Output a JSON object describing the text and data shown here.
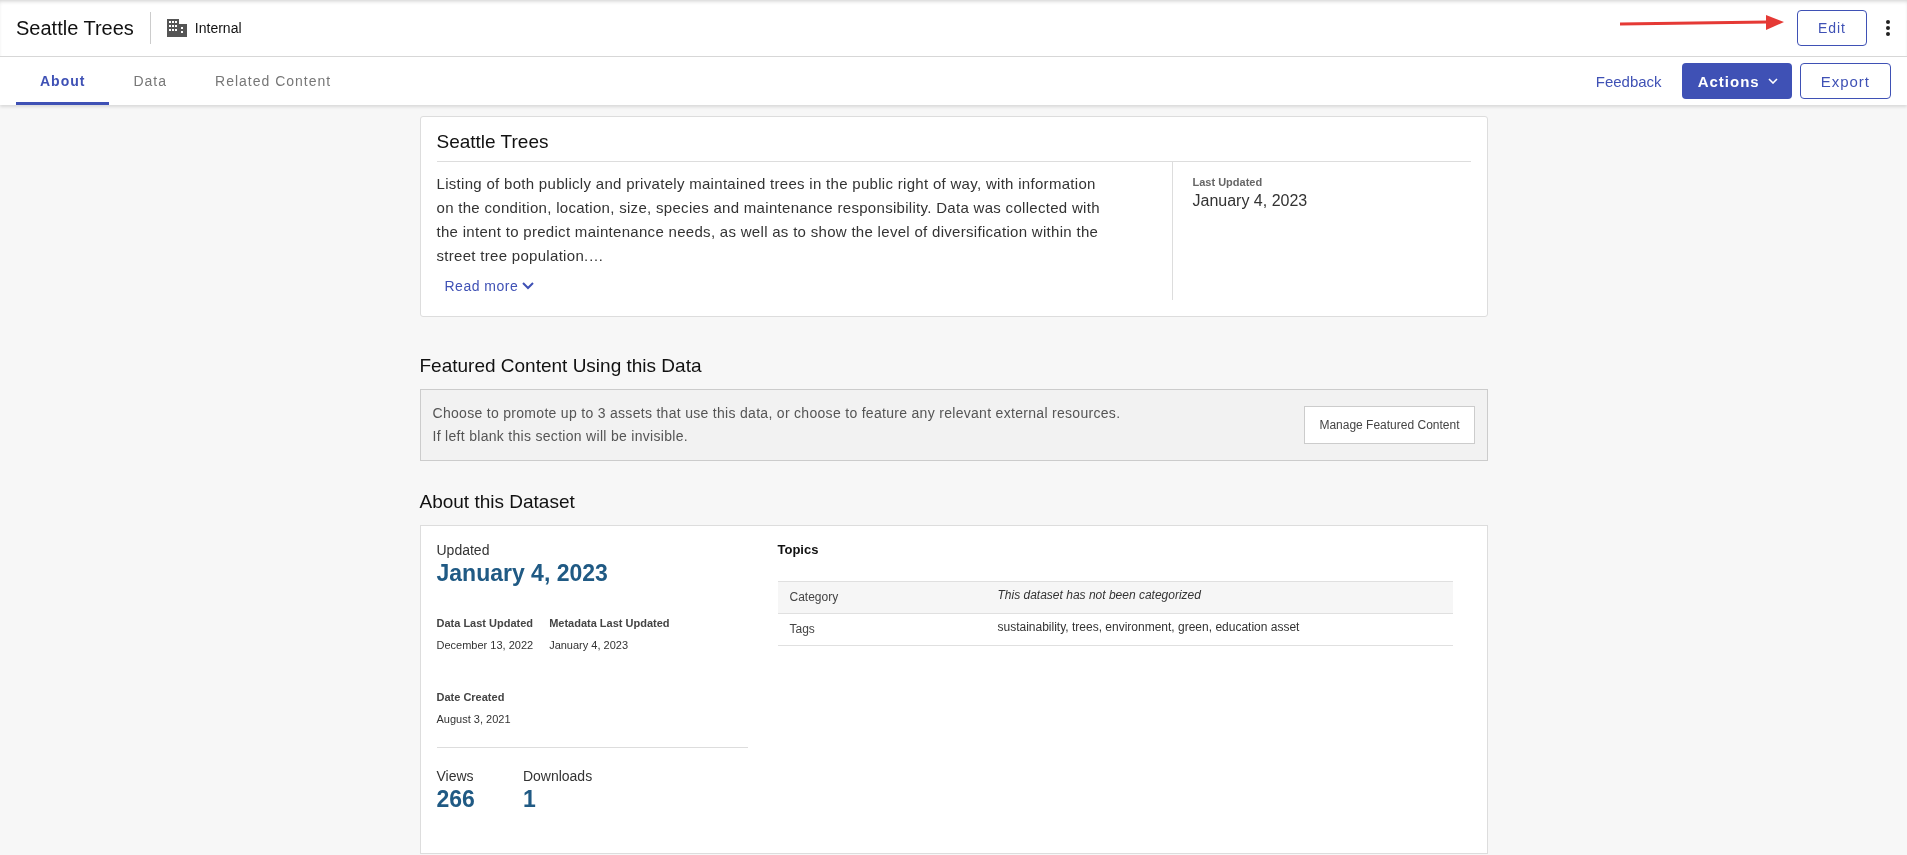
{
  "header": {
    "title": "Seattle Trees",
    "access": "Internal",
    "edit_button": "Edit"
  },
  "tabs": [
    {
      "label": "About",
      "selected": true
    },
    {
      "label": "Data",
      "selected": false
    },
    {
      "label": "Related Content",
      "selected": false
    }
  ],
  "toolbar": {
    "feedback": "Feedback",
    "actions": "Actions",
    "export": "Export"
  },
  "summary": {
    "title": "Seattle Trees",
    "description": "Listing of both publicly and privately maintained trees in the public right of way, with information on the condition, location, size, species and maintenance responsibility. Data was collected with the intent to predict maintenance needs, as well as to show the level of diversification within the street tree population.…",
    "read_more": "Read more",
    "last_updated_label": "Last Updated",
    "last_updated": "January 4, 2023"
  },
  "featured": {
    "heading": "Featured Content Using this Data",
    "text": "Choose to promote up to 3 assets that use this data, or choose to feature any relevant external resources. If left blank this section will be invisible.",
    "button": "Manage Featured Content"
  },
  "about": {
    "heading": "About this Dataset",
    "updated_label": "Updated",
    "updated": "January 4, 2023",
    "dates": [
      {
        "label": "Data Last Updated",
        "value": "December 13, 2022"
      },
      {
        "label": "Metadata Last Updated",
        "value": "January 4, 2023"
      }
    ],
    "created_label": "Date Created",
    "created": "August 3, 2021",
    "stats": [
      {
        "label": "Views",
        "value": "266"
      },
      {
        "label": "Downloads",
        "value": "1"
      }
    ],
    "topics_heading": "Topics",
    "topics": [
      {
        "label": "Category",
        "value": "This dataset has not been categorized",
        "kind": "empty"
      },
      {
        "label": "Tags",
        "value": "sustainability, trees, environment, green, education asset",
        "kind": "tags"
      }
    ]
  }
}
